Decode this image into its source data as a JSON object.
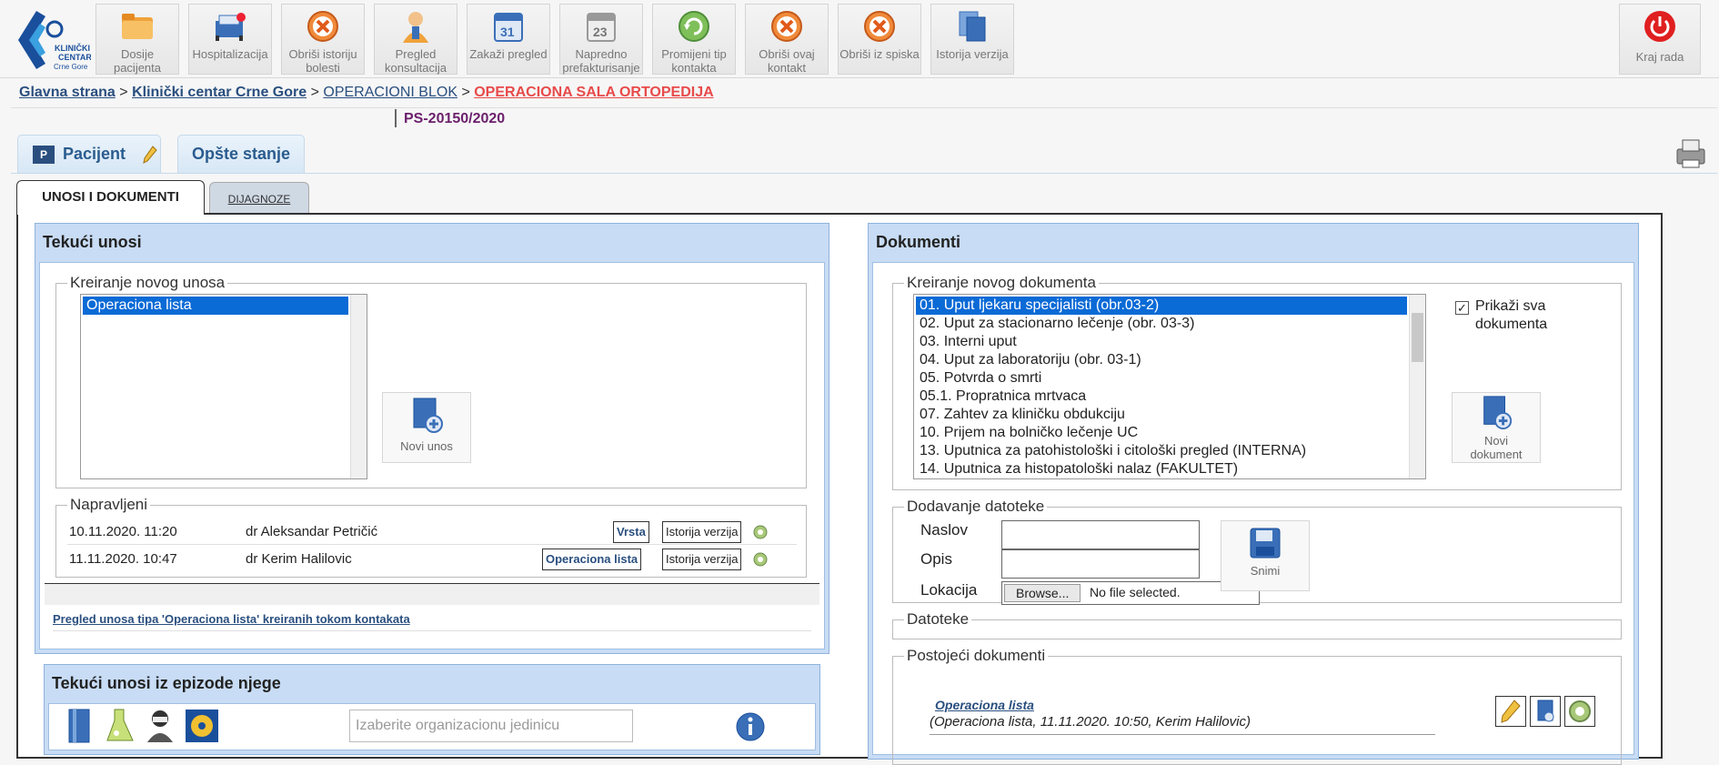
{
  "toolbar": {
    "logo": {
      "line1": "KLINIČKI",
      "line2": "CENTAR",
      "line3": "Crne Gore"
    },
    "items": [
      {
        "label": "Dosije pacijenta",
        "icon": "folder-icon"
      },
      {
        "label": "Hospitalizacija",
        "icon": "hospital-bed-icon"
      },
      {
        "label": "Obriši istoriju bolesti",
        "icon": "delete-icon"
      },
      {
        "label": "Pregled konsultacija",
        "icon": "doctor-icon"
      },
      {
        "label": "Zakaži pregled",
        "icon": "calendar-icon"
      },
      {
        "label": "Napredno prefakturisanje",
        "icon": "invoice-calendar-icon"
      },
      {
        "label": "Promijeni tip kontakta",
        "icon": "refresh-icon"
      },
      {
        "label": "Obriši ovaj kontakt",
        "icon": "delete-icon"
      },
      {
        "label": "Obriši iz spiska",
        "icon": "delete-icon"
      },
      {
        "label": "Istorija verzija",
        "icon": "versions-icon"
      }
    ],
    "logout": {
      "label": "Kraj rada",
      "icon": "power-icon"
    }
  },
  "breadcrumb": {
    "items": [
      "Glavna strana",
      "Klinički centar Crne Gore",
      "OPERACIONI BLOK",
      "OPERACIONA SALA ORTOPEDIJA"
    ],
    "separator": ">"
  },
  "case_number": "PS-20150/2020",
  "patient_tabs": [
    {
      "label": "Pacijent",
      "badge": "P"
    },
    {
      "label": "Opšte stanje"
    }
  ],
  "sub_tabs": [
    {
      "label": "UNOSI I DOKUMENTI",
      "active": true
    },
    {
      "label": "DIJAGNOZE",
      "active": false
    }
  ],
  "current_entries": {
    "title": "Tekući unosi",
    "create_legend": "Kreiranje novog unosa",
    "options": [
      "Operaciona lista"
    ],
    "new_button": "Novi unos",
    "made_legend": "Napravljeni",
    "rows": [
      {
        "date": "10.11.2020. 11:20",
        "doctor": "dr Aleksandar Petričić",
        "type": "Vrsta",
        "history": "Istorija verzija"
      },
      {
        "date": "11.11.2020. 10:47",
        "doctor": "dr Kerim Halilovic",
        "type": "Operaciona lista",
        "history": "Istorija verzija"
      }
    ],
    "review_link": "Pregled unosa tipa 'Operaciona lista' kreiranih tokom kontakata"
  },
  "episode": {
    "title": "Tekući unosi iz epizode njege",
    "placeholder": "Izaberite organizacionu jedinicu"
  },
  "documents": {
    "title": "Dokumenti",
    "create_legend": "Kreiranje novog dokumenta",
    "items": [
      "01. Uput ljekaru specijalisti (obr.03-2)",
      "02. Uput za stacionarno lečenje (obr. 03-3)",
      "03. Interni uput",
      "04. Uput za laboratoriju (obr. 03-1)",
      "05. Potvrda o smrti",
      "05.1. Propratnica mrtvaca",
      "07. Zahtev za kliničku obdukciju",
      "10. Prijem na bolničko lečenje UC",
      "13. Uputnica za patohistološki i citološki pregled (INTERNA)",
      "14. Uputnica za histopatološki nalaz (FAKULTET)"
    ],
    "show_all": "Prikaži sva dokumenta",
    "new_button": "Novi dokument",
    "file_legend": "Dodavanje datoteke",
    "naslov": "Naslov",
    "opis": "Opis",
    "lokacija": "Lokacija",
    "browse": "Browse...",
    "no_file": "No file selected.",
    "save": "Snimi",
    "files_legend": "Datoteke",
    "existing_legend": "Postojeći dokumenti",
    "existing_link": "Operaciona lista",
    "existing_desc": "(Operaciona lista, 11.11.2020. 10:50, Kerim Halilovic)"
  }
}
